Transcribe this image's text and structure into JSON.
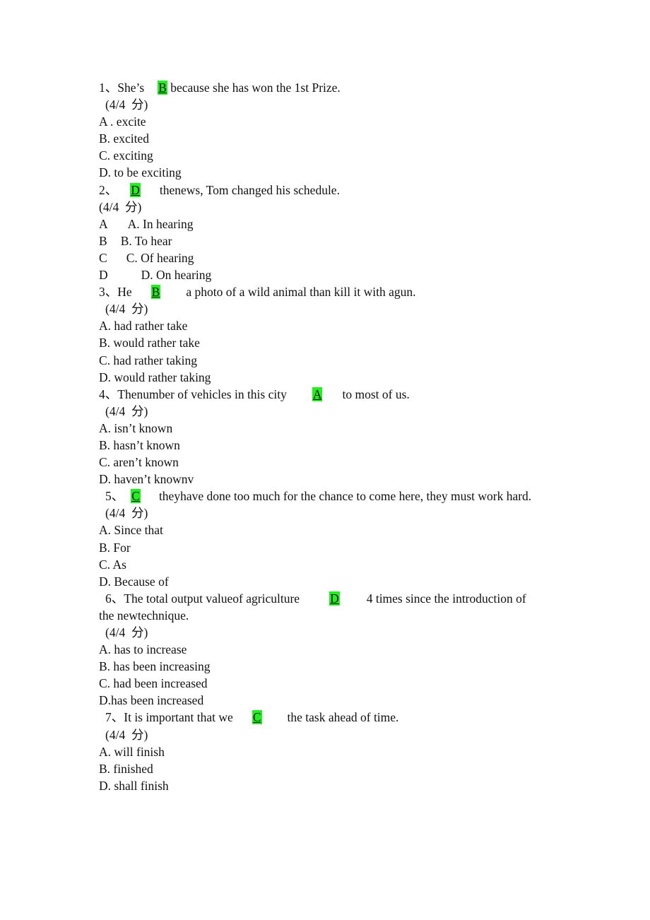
{
  "questions": [
    {
      "number": "1、",
      "before": "She’s",
      "answer": "B",
      "after": "because she has won the 1st Prize.",
      "score": "(4/4  分)",
      "options": [
        "A . excite",
        "B. excited",
        "C. exciting",
        "D. to be exciting"
      ]
    },
    {
      "number": "2、",
      "before": "",
      "answer": "D",
      "after": "thenews, Tom changed his schedule.",
      "score": "(4/4  分)",
      "options": [
        {
          "letter": "A",
          "text": "A. In hearing"
        },
        {
          "letter": "B",
          "text": "B. To hear"
        },
        {
          "letter": "C",
          "text": "C. Of hearing"
        },
        {
          "letter": "D",
          "text": "D. On hearing"
        }
      ]
    },
    {
      "number": "3、",
      "before": "He",
      "answer": "B",
      "after": "a photo of a wild animal than kill it with agun.",
      "score": "(4/4  分)",
      "options": [
        "A. had rather take",
        "B. would rather take",
        "C. had rather taking",
        "D. would rather taking"
      ]
    },
    {
      "number": "4、",
      "before": "Thenumber of vehicles in this city",
      "answer": "A",
      "after": "to most of us.",
      "score": "(4/4  分)",
      "options": [
        "A. isn’t known",
        "B. hasn’t known",
        "C. aren’t known",
        "D. haven’t knownv"
      ]
    },
    {
      "number": "5、",
      "before": "",
      "answer": "C",
      "after": "theyhave done too much for the chance to come here, they must work hard.",
      "score": "(4/4  分)",
      "options": [
        "A. Since that",
        "B. For",
        "C. As",
        "D. Because of"
      ]
    },
    {
      "number": "6、",
      "before": "The total output valueof agriculture",
      "answer": "D",
      "after": "4 times since the introduction of",
      "after_wrap": "the newtechnique.",
      "score": "(4/4  分)",
      "options": [
        "A. has to increase",
        "B. has been increasing",
        "C. had been increased",
        "D.has been increased"
      ]
    },
    {
      "number": "7、",
      "before": "It is important that we",
      "answer": "C",
      "after": "the task ahead of time.",
      "score": "(4/4  分)",
      "options": [
        "A. will finish",
        "B. finished",
        "D. shall finish"
      ]
    }
  ]
}
